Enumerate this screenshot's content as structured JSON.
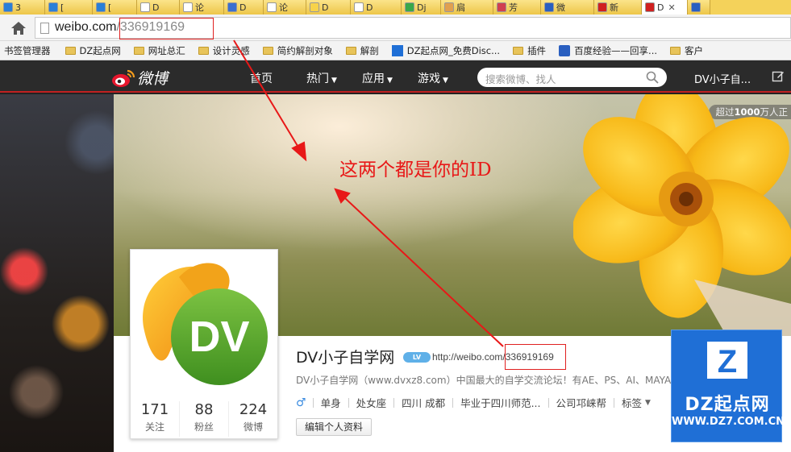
{
  "browser": {
    "tabs": [
      {
        "label": "3",
        "favicon_color": "#2a7fd8"
      },
      {
        "label": "[",
        "favicon_color": "#2a7fd8"
      },
      {
        "label": "[",
        "favicon_color": "#2a7fd8"
      },
      {
        "label": "D",
        "favicon_color": "#ffffff"
      },
      {
        "label": "论",
        "favicon_color": "#ffffff"
      },
      {
        "label": "D",
        "favicon_color": "#3b6fd0"
      },
      {
        "label": "论",
        "favicon_color": "#ffffff"
      },
      {
        "label": "D",
        "favicon_color": "#f7d34a"
      },
      {
        "label": "D",
        "favicon_color": "#ffffff"
      },
      {
        "label": "Dj",
        "favicon_color": "#3aa84a"
      },
      {
        "label": "扃",
        "favicon_color": "#e0a050"
      },
      {
        "label": "芳",
        "favicon_color": "#d04050"
      },
      {
        "label": "微",
        "favicon_color": "#2a5fc0"
      },
      {
        "label": "新",
        "favicon_color": "#d02020"
      },
      {
        "label": "D",
        "favicon_color": "#d02020"
      },
      {
        "label": "",
        "favicon_color": "#2a5fc0"
      }
    ],
    "address": {
      "domain": "weibo.com",
      "path": "/336919169"
    },
    "bookmarks": [
      {
        "label": "书签管理器",
        "icon": "none"
      },
      {
        "label": "DZ起点网",
        "icon": "folder"
      },
      {
        "label": "网址总汇",
        "icon": "folder"
      },
      {
        "label": "设计灵感",
        "icon": "folder"
      },
      {
        "label": "简约解剖对象",
        "icon": "folder"
      },
      {
        "label": "解剖",
        "icon": "folder"
      },
      {
        "label": "DZ起点网_免费Disc...",
        "icon": "dz-icon"
      },
      {
        "label": "插件",
        "icon": "folder"
      },
      {
        "label": "百度经验——回享...",
        "icon": "baidu-icon"
      },
      {
        "label": "客户",
        "icon": "folder"
      }
    ]
  },
  "weibo": {
    "logo_text": "微博",
    "nav": {
      "home": "首页",
      "hot": "热门",
      "apps": "应用",
      "games": "游戏"
    },
    "search_placeholder": "搜索微博、找人",
    "username": "DV小子自...",
    "cover_badge_pre": "超过",
    "cover_badge_num": "1000",
    "cover_badge_post": "万人正",
    "profile": {
      "name": "DV小子自学网",
      "vip": "LV",
      "url_domain": "http://weibo.com/",
      "url_id": "336919169",
      "description": "DV小子自学网（www.dvxz8.com）中国最大的自学交流论坛！有AE、PS、AI、MAYA、Discuz、",
      "gender": "♂",
      "tags": [
        "单身",
        "处女座",
        "四川 成都",
        "毕业于四川师范...",
        "公司邛崃帮",
        "标签"
      ],
      "edit_button": "编辑个人资料",
      "avatar_text": "DV",
      "stats": [
        {
          "num": "171",
          "label": "关注"
        },
        {
          "num": "88",
          "label": "粉丝"
        },
        {
          "num": "224",
          "label": "微博"
        }
      ]
    }
  },
  "annotation": {
    "text": "这两个都是你的ID",
    "color": "#e81818"
  },
  "watermark": {
    "mark": "Z",
    "name": "DZ起点网",
    "url": "WWW.DZ7.COM.CN"
  }
}
